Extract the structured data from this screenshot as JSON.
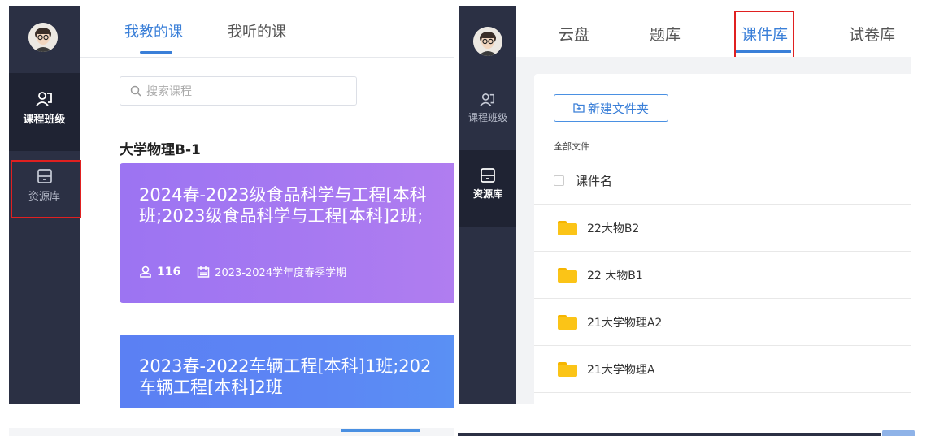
{
  "left_panel": {
    "sidebar": {
      "items": [
        {
          "label": "课程班级",
          "icon": "class-icon"
        },
        {
          "label": "资源库",
          "icon": "resource-icon"
        }
      ]
    },
    "tabs": [
      {
        "label": "我教的课"
      },
      {
        "label": "我听的课"
      }
    ],
    "search": {
      "placeholder": "搜索课程"
    },
    "group_title": "大学物理B-1",
    "courses": [
      {
        "title_line1": "2024春-2023级食品科学与工程[本科",
        "title_line2": "班;2023级食品科学与工程[本科]2班;",
        "students": "116",
        "term": "2023-2024学年度春季学期"
      },
      {
        "title_line1": "2023春-2022车辆工程[本科]1班;202",
        "title_line2": "车辆工程[本科]2班"
      }
    ]
  },
  "right_panel": {
    "sidebar": {
      "items": [
        {
          "label": "课程班级",
          "icon": "class-icon"
        },
        {
          "label": "资源库",
          "icon": "resource-icon"
        }
      ]
    },
    "tabs": [
      {
        "label": "云盘"
      },
      {
        "label": "题库"
      },
      {
        "label": "课件库"
      },
      {
        "label": "试卷库"
      }
    ],
    "new_folder_label": "新建文件夹",
    "breadcrumb": "全部文件",
    "column_header": "课件名",
    "folders": [
      {
        "name": "22大物B2"
      },
      {
        "name": "22 大物B1"
      },
      {
        "name": "21大学物理A2"
      },
      {
        "name": "21大学物理A"
      }
    ]
  },
  "colors": {
    "sidebar": "#2b3044",
    "accent": "#4a90e2",
    "highlight_box": "#e02020",
    "card_purple": "#a779f1",
    "card_blue": "#5c86f4",
    "folder": "#fbc417"
  }
}
